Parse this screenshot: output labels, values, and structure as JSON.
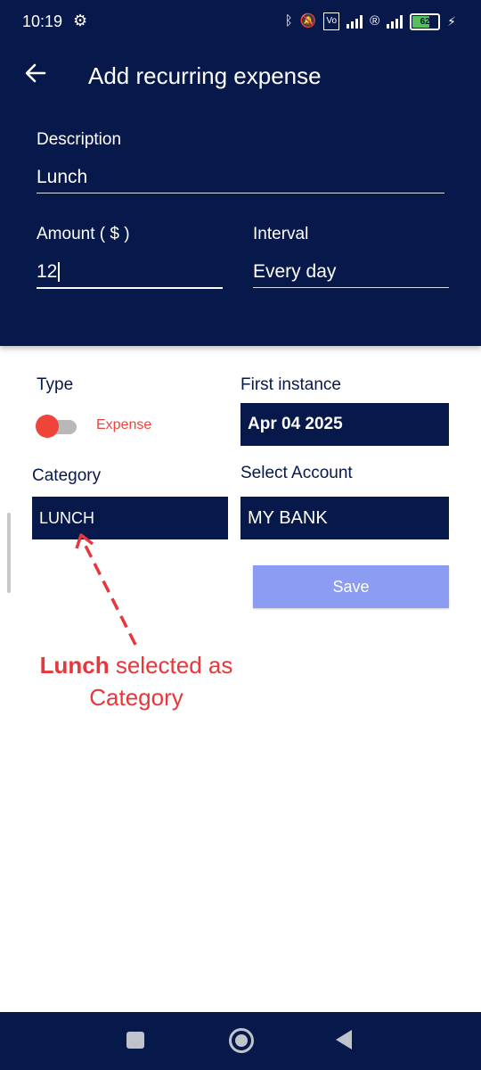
{
  "status_bar": {
    "time": "10:19",
    "battery": "62"
  },
  "header": {
    "title": "Add recurring expense"
  },
  "description": {
    "label": "Description",
    "value": "Lunch"
  },
  "amount": {
    "label": "Amount ( $ )",
    "value": "12"
  },
  "interval": {
    "label": "Interval",
    "value": "Every day"
  },
  "type": {
    "label": "Type",
    "toggle_label": "Expense"
  },
  "first_instance": {
    "label": "First instance",
    "value": "Apr 04 2025"
  },
  "category": {
    "label": "Category",
    "value": "LUNCH"
  },
  "account": {
    "label": "Select Account",
    "value": "MY BANK"
  },
  "save_label": "Save",
  "annotation": {
    "bold": "Lunch",
    "line1_rest": " selected as",
    "line2": "Category"
  },
  "colors": {
    "primary": "#07184a",
    "accent_red": "#f0443a",
    "save_button": "#8c9cf3"
  },
  "icons": [
    "gear-icon",
    "bluetooth-icon",
    "bell-off-icon",
    "volte-icon",
    "signal-icon",
    "battery-icon",
    "back-arrow-icon",
    "recent-apps-icon",
    "home-icon",
    "nav-back-icon"
  ]
}
